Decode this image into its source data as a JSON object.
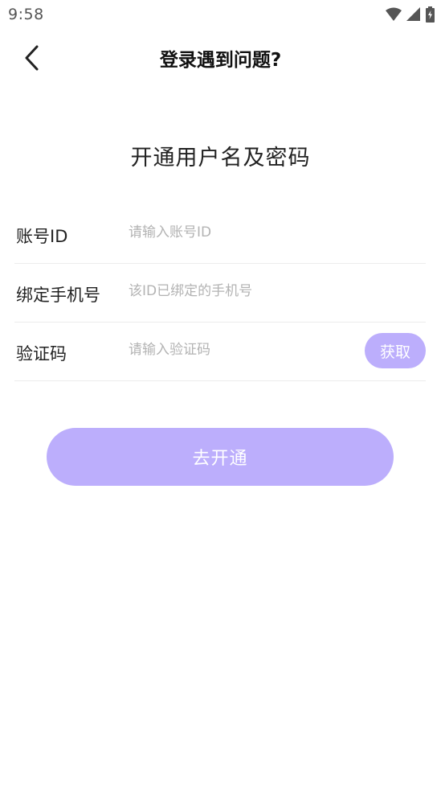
{
  "status_bar": {
    "time": "9:58",
    "icons": [
      "wifi-icon",
      "signal-icon",
      "battery-charging-icon"
    ]
  },
  "header": {
    "back_icon": "chevron-left-icon",
    "title": "登录遇到问题?"
  },
  "section_title": "开通用户名及密码",
  "form": {
    "account_id": {
      "label": "账号ID",
      "value": "",
      "placeholder": "请输入账号ID"
    },
    "phone": {
      "label": "绑定手机号",
      "value": "",
      "placeholder": "该ID已绑定的手机号"
    },
    "verification_code": {
      "label": "验证码",
      "value": "",
      "placeholder": "请输入验证码",
      "fetch_label": "获取"
    }
  },
  "submit_label": "去开通",
  "colors": {
    "accent": "#bcaefc",
    "divider": "#ececec",
    "placeholder": "#b3b3b3"
  }
}
